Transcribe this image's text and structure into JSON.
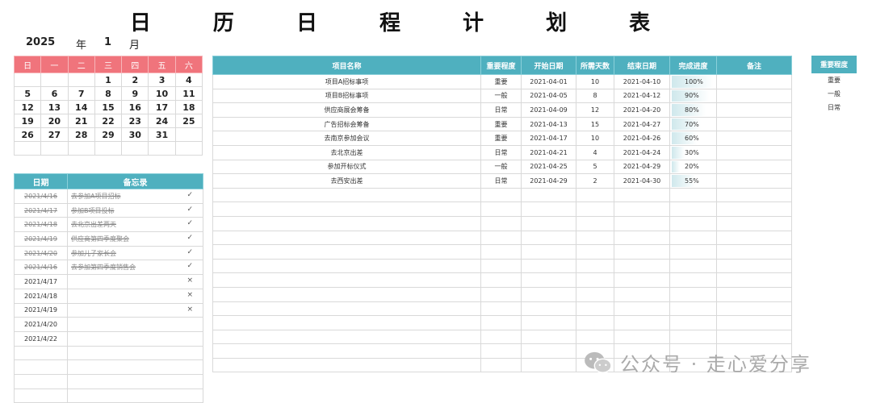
{
  "title": "日 历 日 程 计 划 表",
  "calendar": {
    "year": "2025",
    "year_label": "年",
    "month": "1",
    "month_label": "月",
    "weekdays": [
      "日",
      "一",
      "二",
      "三",
      "四",
      "五",
      "六"
    ],
    "weeks": [
      [
        "",
        "",
        "",
        "1",
        "2",
        "3",
        "4"
      ],
      [
        "5",
        "6",
        "7",
        "8",
        "9",
        "10",
        "11"
      ],
      [
        "12",
        "13",
        "14",
        "15",
        "16",
        "17",
        "18"
      ],
      [
        "19",
        "20",
        "21",
        "22",
        "23",
        "24",
        "25"
      ],
      [
        "26",
        "27",
        "28",
        "29",
        "30",
        "31",
        ""
      ],
      [
        "",
        "",
        "",
        "",
        "",
        "",
        ""
      ]
    ]
  },
  "memo": {
    "headers": [
      "日期",
      "备忘录"
    ],
    "rows": [
      {
        "date": "2021/4/16",
        "text": "去参加A项目招标",
        "mark": "✓",
        "done": true
      },
      {
        "date": "2021/4/17",
        "text": "参加B项目投标",
        "mark": "✓",
        "done": true
      },
      {
        "date": "2021/4/18",
        "text": "去北京出差两天",
        "mark": "✓",
        "done": true
      },
      {
        "date": "2021/4/19",
        "text": "供应商第四季度聚会",
        "mark": "✓",
        "done": true
      },
      {
        "date": "2021/4/20",
        "text": "参加儿子家长会",
        "mark": "✓",
        "done": true
      },
      {
        "date": "2021/4/16",
        "text": "去参加第四季度销售会",
        "mark": "✓",
        "done": true
      },
      {
        "date": "2021/4/17",
        "text": "",
        "mark": "×",
        "done": false
      },
      {
        "date": "2021/4/18",
        "text": "",
        "mark": "×",
        "done": false
      },
      {
        "date": "2021/4/19",
        "text": "",
        "mark": "×",
        "done": false
      },
      {
        "date": "2021/4/20",
        "text": "",
        "mark": "",
        "done": false
      },
      {
        "date": "2021/4/22",
        "text": "",
        "mark": "",
        "done": false
      },
      {
        "date": "",
        "text": "",
        "mark": "",
        "done": false
      },
      {
        "date": "",
        "text": "",
        "mark": "",
        "done": false
      },
      {
        "date": "",
        "text": "",
        "mark": "",
        "done": false
      },
      {
        "date": "",
        "text": "",
        "mark": "",
        "done": false
      }
    ]
  },
  "projects": {
    "headers": [
      "项目名称",
      "重要程度",
      "开始日期",
      "所需天数",
      "结束日期",
      "完成进度",
      "备注"
    ],
    "rows": [
      {
        "name": "项目A招标事项",
        "priority": "重要",
        "start": "2021-04-01",
        "days": "10",
        "end": "2021-04-10",
        "progress_label": "100%",
        "progress": 1.0,
        "note": ""
      },
      {
        "name": "项目B招标事项",
        "priority": "一般",
        "start": "2021-04-05",
        "days": "8",
        "end": "2021-04-12",
        "progress_label": "90%",
        "progress": 0.9,
        "note": ""
      },
      {
        "name": "供应商展会筹备",
        "priority": "日常",
        "start": "2021-04-09",
        "days": "12",
        "end": "2021-04-20",
        "progress_label": "80%",
        "progress": 0.8,
        "note": ""
      },
      {
        "name": "广告招标会筹备",
        "priority": "重要",
        "start": "2021-04-13",
        "days": "15",
        "end": "2021-04-27",
        "progress_label": "70%",
        "progress": 0.7,
        "note": ""
      },
      {
        "name": "去南京参加会议",
        "priority": "重要",
        "start": "2021-04-17",
        "days": "10",
        "end": "2021-04-26",
        "progress_label": "60%",
        "progress": 0.6,
        "note": ""
      },
      {
        "name": "去北京出差",
        "priority": "日常",
        "start": "2021-04-21",
        "days": "4",
        "end": "2021-04-24",
        "progress_label": "30%",
        "progress": 0.3,
        "note": ""
      },
      {
        "name": "参加开标仪式",
        "priority": "一般",
        "start": "2021-04-25",
        "days": "5",
        "end": "2021-04-29",
        "progress_label": "20%",
        "progress": 0.2,
        "note": ""
      },
      {
        "name": "去西安出差",
        "priority": "日常",
        "start": "2021-04-29",
        "days": "2",
        "end": "2021-04-30",
        "progress_label": "55%",
        "progress": 0.55,
        "note": ""
      }
    ],
    "empty_rows": 13
  },
  "priority_legend": {
    "header": "重要程度",
    "items": [
      "重要",
      "一般",
      "日常"
    ]
  },
  "watermark": {
    "text": "公众号 · 走心爱分享",
    "icon": "wechat-icon"
  }
}
